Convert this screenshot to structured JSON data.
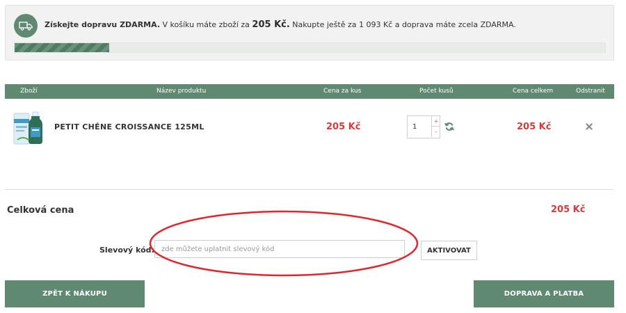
{
  "shipping": {
    "title": "Získejte dopravu ZDARMA.",
    "text_before": "V košíku máte zboží za",
    "cart_amount": "205 Kč.",
    "text_after": "Nakupte ještě za 1 093 Kč a doprava máte zcela  ZDARMA.",
    "progress_percent": 16,
    "icon": "truck-icon"
  },
  "table": {
    "headers": {
      "item": "Zboží",
      "name": "Název produktu",
      "unit_price": "Cena za kus",
      "quantity": "Počet kusů",
      "total_price": "Cena celkem",
      "remove": "Odstranit"
    },
    "rows": [
      {
        "name": "PETIT CHÉNE CROISSANCE 125ML",
        "unit_price": "205 Kč",
        "quantity": "1",
        "total_price": "205 Kč"
      }
    ]
  },
  "summary": {
    "total_label": "Celková cena",
    "total_value": "205 Kč"
  },
  "discount": {
    "label": "Slevový kód:",
    "placeholder": "zde můžete uplatnit slevový kód",
    "button": "AKTIVOVAT"
  },
  "buttons": {
    "back": "ZPĚT K NÁKUPU",
    "next": "DOPRAVA A PLATBA"
  },
  "colors": {
    "accent": "#5f8a71",
    "price": "#d63b3b",
    "highlight": "#e0262c"
  }
}
